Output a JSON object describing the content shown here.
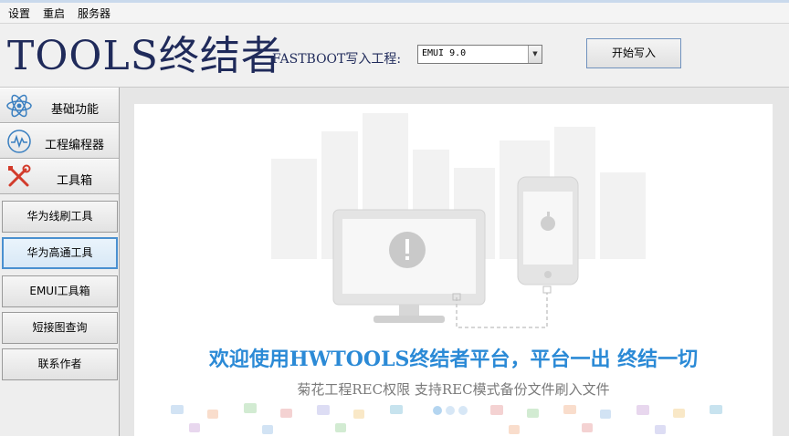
{
  "menu": {
    "items": [
      "设置",
      "重启",
      "服务器"
    ]
  },
  "header": {
    "app_title": "TOOLS终结者",
    "fastboot_label": "FASTBOOT写入工程:",
    "fastboot_select_value": "EMUI 9.0",
    "start_button": "开始写入"
  },
  "sidebar": {
    "nav": [
      {
        "label": "基础功能",
        "icon": "atom-icon"
      },
      {
        "label": "工程编程器",
        "icon": "wave-circle-icon"
      },
      {
        "label": "工具箱",
        "icon": "tools-icon"
      }
    ],
    "tools": [
      {
        "label": "华为线刷工具",
        "active": false
      },
      {
        "label": "华为高通工具",
        "active": true
      },
      {
        "label": "EMUI工具箱",
        "active": false
      },
      {
        "label": "短接图查询",
        "active": false
      },
      {
        "label": "联系作者",
        "active": false
      }
    ]
  },
  "main": {
    "welcome": "欢迎使用HWTOOLS终结者平台，平台一出 终结一切",
    "subtitle": "菊花工程REC权限 支持REC模式备份文件刷入文件",
    "illustration_icons": [
      "monitor-icon",
      "phone-icon",
      "apple-icon",
      "warning-icon"
    ]
  },
  "colors": {
    "title": "#1f2a5a",
    "welcome": "#2b8ad6",
    "active_border": "#4a90d0"
  }
}
